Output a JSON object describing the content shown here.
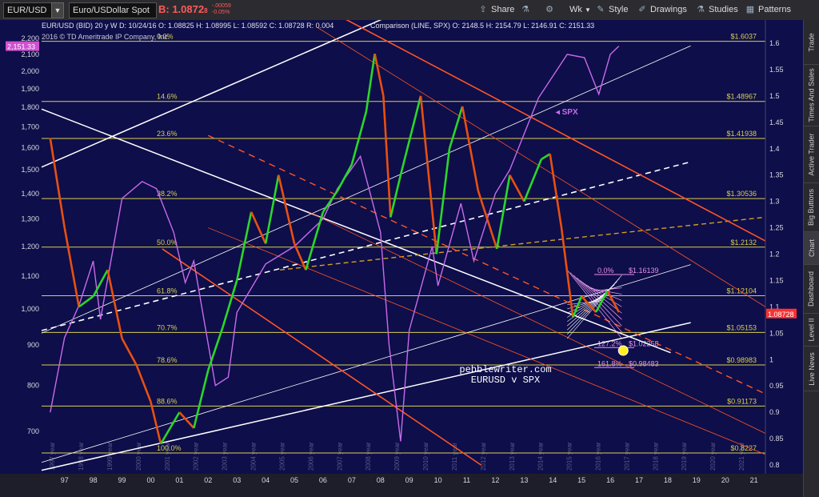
{
  "toolbar": {
    "symbol": "EUR/USD",
    "description": "Euro/USDollar Spot",
    "last_label": "B: 1.0872",
    "last_small": "8",
    "change_1": "-.00059",
    "change_2": "-0.05%",
    "buttons": [
      {
        "label": "Share",
        "icon": "share-icon"
      },
      {
        "label": "",
        "icon": "flask-icon"
      },
      {
        "label": "",
        "icon": "gear-icon"
      },
      {
        "label": "Wk",
        "icon": "chevron-down-icon"
      },
      {
        "label": "Style",
        "icon": "style-icon"
      },
      {
        "label": "Drawings",
        "icon": "pencil-icon"
      },
      {
        "label": "Studies",
        "icon": "flask-icon"
      },
      {
        "label": "Patterns",
        "icon": "patterns-icon"
      }
    ]
  },
  "info_bar": {
    "copyright": "2016 © TD Ameritrade IP Company, Inc.",
    "line": "EUR/USD (BID) 20 y W    D: 10/24/16    O: 1.08825    H: 1.08995    L: 1.08592    C: 1.08728    R: 0.004",
    "comparison": "Comparison (LINE, SPX)    O: 2148.5    H: 2154.79    L: 2146.91    C: 2151.33"
  },
  "sidebar_tabs": [
    "Trade",
    "Times And Sales",
    "Active Trader",
    "Big Buttons",
    "Chart",
    "Dashboard",
    "Level II",
    "Live News"
  ],
  "colors": {
    "background": "#0e0e4a",
    "candle_up": "#2bd62b",
    "candle_down": "#e85010",
    "spx": "#c96be8",
    "fib": "#d8d050",
    "trend_red": "#ff5522",
    "trend_white": "#ffffff",
    "trend_gold": "#d2a020",
    "price_tag": "#ff3030",
    "spx_tag": "#d050d0"
  },
  "chart_data": {
    "type": "line",
    "title": "",
    "watermark_1": "pebblewriter.com",
    "watermark_2": "EURUSD v SPX",
    "series": [
      {
        "name": "EUR/USD",
        "axis": "right",
        "x": [
          1997.0,
          1997.5,
          1998.0,
          1998.5,
          1999.0,
          1999.5,
          2000.0,
          2000.5,
          2000.85,
          2001.5,
          2002.0,
          2002.5,
          2003.0,
          2003.5,
          2004.0,
          2004.5,
          2004.95,
          2005.5,
          2005.9,
          2006.5,
          2007.0,
          2007.5,
          2008.0,
          2008.3,
          2008.6,
          2008.85,
          2009.2,
          2009.9,
          2010.45,
          2010.9,
          2011.35,
          2011.9,
          2012.55,
          2013.0,
          2013.5,
          2014.1,
          2014.4,
          2014.8,
          2015.2,
          2015.5,
          2016.0,
          2016.4,
          2016.8
        ],
        "y": [
          1.42,
          1.25,
          1.1,
          1.12,
          1.17,
          1.04,
          0.99,
          0.92,
          0.84,
          0.9,
          0.87,
          0.98,
          1.06,
          1.15,
          1.28,
          1.22,
          1.35,
          1.22,
          1.17,
          1.28,
          1.32,
          1.37,
          1.47,
          1.58,
          1.5,
          1.27,
          1.35,
          1.5,
          1.2,
          1.4,
          1.48,
          1.32,
          1.21,
          1.35,
          1.3,
          1.38,
          1.39,
          1.25,
          1.08,
          1.12,
          1.09,
          1.13,
          1.09
        ]
      },
      {
        "name": "SPX",
        "axis": "left",
        "x": [
          1997.0,
          1997.5,
          1998.0,
          1998.5,
          1998.75,
          1999.5,
          2000.2,
          2000.7,
          2001.3,
          2001.7,
          2002.0,
          2002.75,
          2003.2,
          2003.5,
          2004.5,
          2005.5,
          2006.5,
          2007.0,
          2007.8,
          2008.5,
          2008.8,
          2009.2,
          2009.5,
          2010.3,
          2010.5,
          2011.3,
          2011.75,
          2012.5,
          2013.0,
          2014.0,
          2015.0,
          2015.6,
          2016.1,
          2016.5,
          2016.8
        ],
        "y": [
          740,
          920,
          1010,
          1150,
          970,
          1380,
          1450,
          1420,
          1250,
          1080,
          1150,
          800,
          820,
          990,
          1140,
          1200,
          1300,
          1420,
          1560,
          1250,
          900,
          680,
          940,
          1200,
          1070,
          1360,
          1150,
          1400,
          1500,
          1850,
          2100,
          2080,
          1870,
          2100,
          2151.33
        ]
      }
    ],
    "left_axis": {
      "ticks": [
        "2,200",
        "2,100",
        "2,000",
        "1,900",
        "1,800",
        "1,700",
        "1,600",
        "1,500",
        "1,400",
        "1,300",
        "1,200",
        "1,100",
        "1,000",
        "900",
        "800",
        "700"
      ],
      "values": [
        2200,
        2100,
        2000,
        1900,
        1800,
        1700,
        1600,
        1500,
        1400,
        1300,
        1200,
        1100,
        1000,
        900,
        800,
        700
      ],
      "scale": "log",
      "current_tag": "2,151.33"
    },
    "right_axis": {
      "ticks": [
        "1.6",
        "1.55",
        "1.5",
        "1.45",
        "1.4",
        "1.35",
        "1.3",
        "1.25",
        "1.2",
        "1.15",
        "1.1",
        "1.05",
        "1",
        "0.95",
        "0.9",
        "0.85",
        "0.8"
      ],
      "values": [
        1.6,
        1.55,
        1.5,
        1.45,
        1.4,
        1.35,
        1.3,
        1.25,
        1.2,
        1.15,
        1.1,
        1.05,
        1.0,
        0.95,
        0.9,
        0.85,
        0.8
      ],
      "current_tag": "1.08728"
    },
    "x_axis": {
      "ticks": [
        "97",
        "98",
        "99",
        "00",
        "01",
        "02",
        "03",
        "04",
        "05",
        "06",
        "07",
        "08",
        "09",
        "10",
        "11",
        "12",
        "13",
        "14",
        "15",
        "16",
        "17",
        "18",
        "19",
        "20",
        "21"
      ],
      "values": [
        1997,
        1998,
        1999,
        2000,
        2001,
        2002,
        2003,
        2004,
        2005,
        2006,
        2007,
        2008,
        2009,
        2010,
        2011,
        2012,
        2013,
        2014,
        2015,
        2016,
        2017,
        2018,
        2019,
        2020,
        2021
      ],
      "range": [
        1996.7,
        2021.9
      ]
    },
    "fib_levels": [
      {
        "pct": "0.0%",
        "value": 1.6037,
        "label": "$1.6037"
      },
      {
        "pct": "14.6%",
        "value": 1.4896,
        "label": "$1.48967"
      },
      {
        "pct": "23.6%",
        "value": 1.4193,
        "label": "$1.41938"
      },
      {
        "pct": "38.2%",
        "value": 1.3053,
        "label": "$1.30536"
      },
      {
        "pct": "50.0%",
        "value": 1.2132,
        "label": "$1.2132"
      },
      {
        "pct": "61.8%",
        "value": 1.121,
        "label": "$1.12104"
      },
      {
        "pct": "70.7%",
        "value": 1.0515,
        "label": "$1.05153"
      },
      {
        "pct": "78.6%",
        "value": 0.9898,
        "label": "$0.98983"
      },
      {
        "pct": "88.6%",
        "value": 0.9117,
        "label": "$0.91173"
      },
      {
        "pct": "100.0%",
        "value": 0.8227,
        "label": "$0.8227"
      }
    ],
    "ext_levels": [
      {
        "pct": "0.0%",
        "value": 1.1613,
        "label": "$1.16139"
      },
      {
        "pct": "127.2%",
        "value": 1.0225,
        "label": "$1.02258"
      },
      {
        "pct": "161.8%",
        "value": 0.9848,
        "label": "$0.98483"
      }
    ],
    "annotations": [
      {
        "text": "SPX",
        "x": 2014.6,
        "y": 1.465
      }
    ],
    "target_marker": {
      "x": 2016.95,
      "y": 1.017
    },
    "year_labels": [
      "1996 year",
      "1997 year",
      "1998 year",
      "1999 year",
      "2000 year",
      "2001 year",
      "2002 year",
      "2003 year",
      "2004 year",
      "2005 year",
      "2006 year",
      "2007 year",
      "2008 year",
      "2009 year",
      "2010 year",
      "2011 year",
      "2012 year",
      "2013 year",
      "2014 year",
      "2015 year",
      "2016 year",
      "2017 year",
      "2018 year",
      "2019 year",
      "2020 year",
      "2021 year"
    ],
    "trendlines": [
      {
        "kind": "white",
        "from": [
          1996.7,
          1.365
        ],
        "to": [
          2009.8,
          1.675
        ]
      },
      {
        "kind": "white_thin",
        "from": [
          1996.7,
          1.05
        ],
        "to": [
          2019.3,
          1.595
        ]
      },
      {
        "kind": "white_dash",
        "from": [
          1996.7,
          1.055
        ],
        "to": [
          2019.3,
          1.375
        ]
      },
      {
        "kind": "white",
        "from": [
          1996.7,
          1.475
        ],
        "to": [
          2018.6,
          1.013
        ]
      },
      {
        "kind": "white",
        "from": [
          1996.7,
          0.79
        ],
        "to": [
          2019.3,
          1.07
        ]
      },
      {
        "kind": "white_thin",
        "from": [
          1996.7,
          0.805
        ],
        "to": [
          2019.3,
          1.18
        ]
      },
      {
        "kind": "gold_dash",
        "from": [
          2005.0,
          1.17
        ],
        "to": [
          2021.9,
          1.27
        ]
      },
      {
        "kind": "red",
        "from": [
          2007.3,
          1.645
        ],
        "to": [
          2021.9,
          1.225
        ]
      },
      {
        "kind": "red_thin",
        "from": [
          2006.3,
          1.63
        ],
        "to": [
          2021.9,
          1.1
        ]
      },
      {
        "kind": "red_dash",
        "from": [
          2002.5,
          1.425
        ],
        "to": [
          2021.9,
          0.935
        ]
      },
      {
        "kind": "red_thin",
        "from": [
          2002.5,
          1.25
        ],
        "to": [
          2021.9,
          0.82
        ]
      },
      {
        "kind": "red",
        "from": [
          2000.9,
          1.21
        ],
        "to": [
          2012.0,
          0.8
        ]
      },
      {
        "kind": "red_thin",
        "from": [
          2006.0,
          1.28
        ],
        "to": [
          2021.9,
          0.86
        ]
      }
    ]
  }
}
